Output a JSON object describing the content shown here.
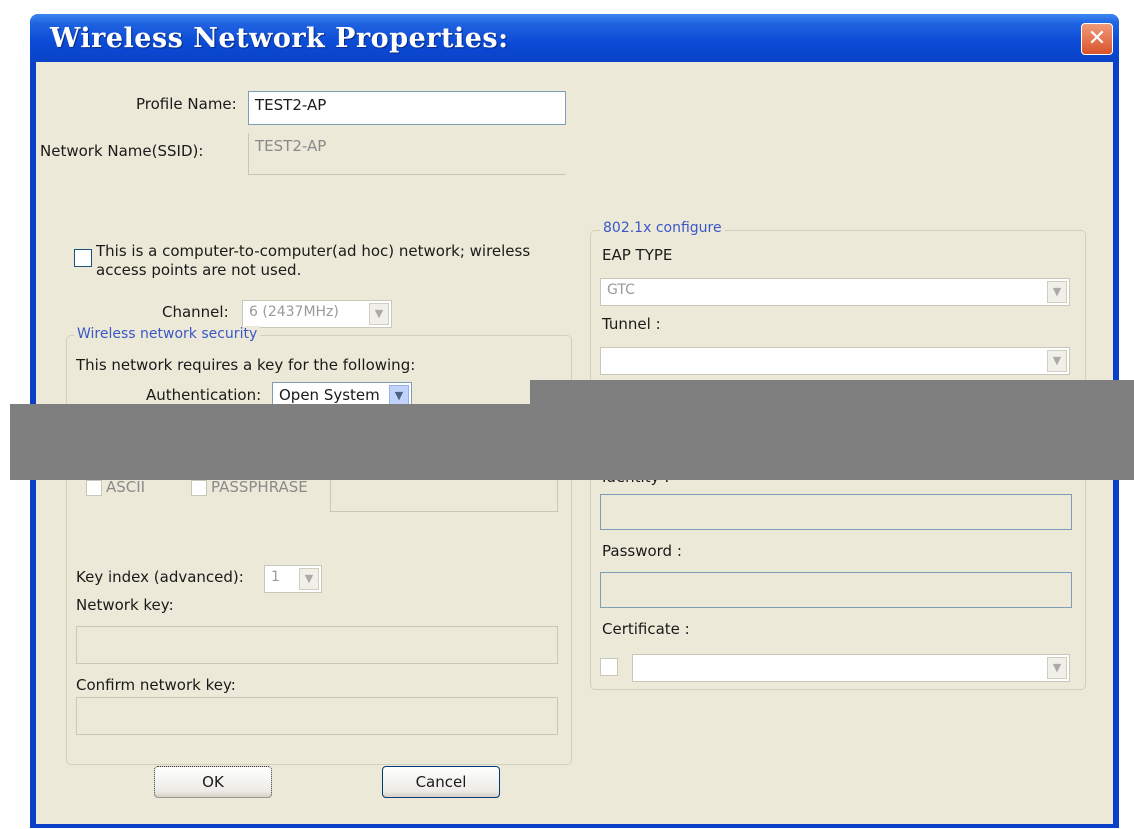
{
  "window": {
    "title": "Wireless Network Properties:"
  },
  "profile": {
    "label": "Profile Name:",
    "value": "TEST2-AP"
  },
  "ssid": {
    "label": "Network Name(SSID):",
    "value": "TEST2-AP"
  },
  "adhoc": {
    "label": "This is a computer-to-computer(ad hoc) network; wireless access points are not used.",
    "checked": false
  },
  "channel": {
    "label": "Channel:",
    "value": "6 (2437MHz)"
  },
  "security": {
    "group_title": "Wireless network security",
    "requires_text": "This network requires a key for the following:",
    "auth_label": "Authentication:",
    "auth_value": "Open System",
    "ascii_label": "ASCII",
    "passphrase_label": "PASSPHRASE",
    "key_index_label": "Key index (advanced):",
    "key_index_value": "1",
    "network_key_label": "Network key:",
    "confirm_key_label": "Confirm network key:"
  },
  "eap": {
    "group_title": "802.1x configure",
    "eap_type_label": "EAP TYPE",
    "eap_type_value": "GTC",
    "tunnel_label": "Tunnel :",
    "identity_label": "Identity :",
    "password_label": "Password :",
    "certificate_label": "Certificate :"
  },
  "buttons": {
    "ok": "OK",
    "cancel": "Cancel"
  }
}
